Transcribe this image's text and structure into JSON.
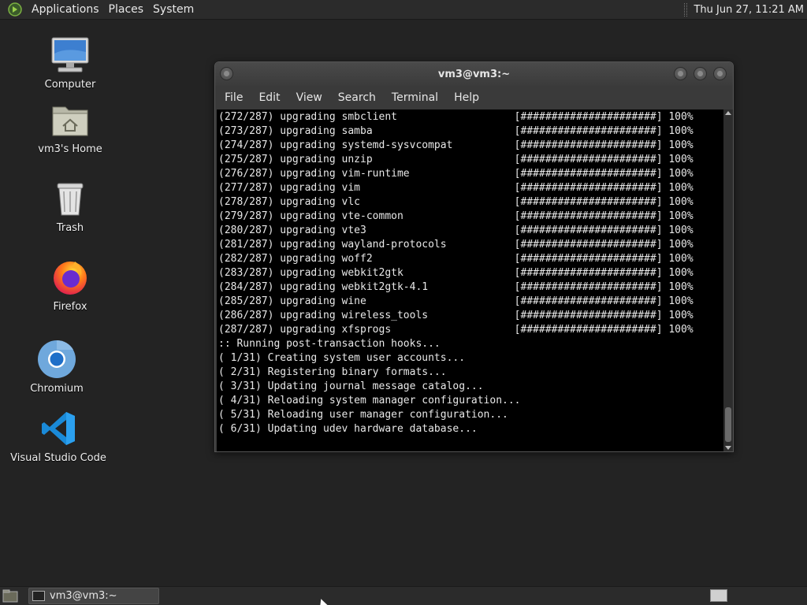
{
  "top_panel": {
    "menu": [
      "Applications",
      "Places",
      "System"
    ],
    "clock": "Thu Jun 27, 11:21 AM"
  },
  "desktop": {
    "icons": [
      {
        "label": "Computer",
        "icon": "computer-icon"
      },
      {
        "label": "vm3's Home",
        "icon": "home-folder-icon"
      },
      {
        "label": "Trash",
        "icon": "trash-icon"
      },
      {
        "label": "Firefox",
        "icon": "firefox-icon"
      },
      {
        "label": "Chromium",
        "icon": "chromium-icon"
      },
      {
        "label": "Visual Studio Code",
        "icon": "vscode-icon"
      }
    ]
  },
  "terminal": {
    "title": "vm3@vm3:~",
    "menu": [
      "File",
      "Edit",
      "View",
      "Search",
      "Terminal",
      "Help"
    ],
    "lines": [
      "(272/287) upgrading smbclient                   [######################] 100%",
      "(273/287) upgrading samba                       [######################] 100%",
      "(274/287) upgrading systemd-sysvcompat          [######################] 100%",
      "(275/287) upgrading unzip                       [######################] 100%",
      "(276/287) upgrading vim-runtime                 [######################] 100%",
      "(277/287) upgrading vim                         [######################] 100%",
      "(278/287) upgrading vlc                         [######################] 100%",
      "(279/287) upgrading vte-common                  [######################] 100%",
      "(280/287) upgrading vte3                        [######################] 100%",
      "(281/287) upgrading wayland-protocols           [######################] 100%",
      "(282/287) upgrading woff2                       [######################] 100%",
      "(283/287) upgrading webkit2gtk                  [######################] 100%",
      "(284/287) upgrading webkit2gtk-4.1              [######################] 100%",
      "(285/287) upgrading wine                        [######################] 100%",
      "(286/287) upgrading wireless_tools              [######################] 100%",
      "(287/287) upgrading xfsprogs                    [######################] 100%",
      ":: Running post-transaction hooks...",
      "( 1/31) Creating system user accounts...",
      "( 2/31) Registering binary formats...",
      "( 3/31) Updating journal message catalog...",
      "( 4/31) Reloading system manager configuration...",
      "( 5/31) Reloading user manager configuration...",
      "( 6/31) Updating udev hardware database..."
    ]
  },
  "taskbar": {
    "window_label": "vm3@vm3:~"
  }
}
